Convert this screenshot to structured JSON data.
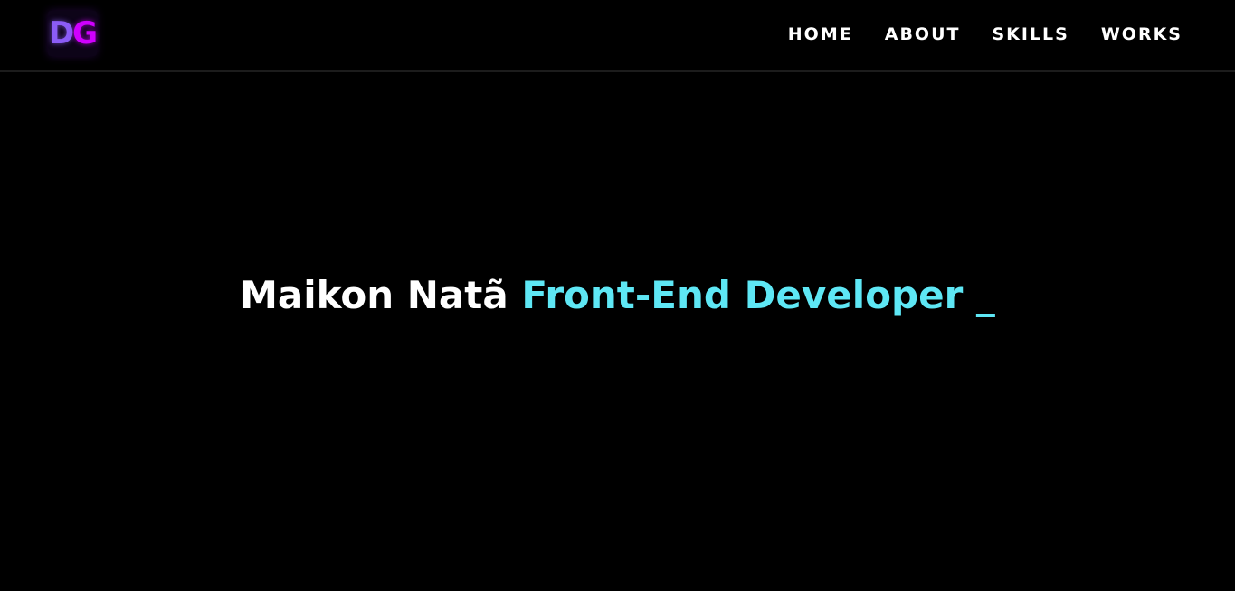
{
  "header": {
    "logo": {
      "letter_1": "D",
      "letter_2": "G",
      "colors": [
        "#8b5cf6",
        "#d000ff"
      ]
    },
    "nav": [
      {
        "label": "HOME"
      },
      {
        "label": "ABOUT"
      },
      {
        "label": "SKILLS"
      },
      {
        "label": "WORKS"
      }
    ]
  },
  "hero": {
    "name": "Maikon Natã",
    "role": "Front-End Developer",
    "cursor": "_",
    "colors": {
      "name": "#ffffff",
      "role": "#5ee7f5",
      "background": "#000000"
    }
  }
}
